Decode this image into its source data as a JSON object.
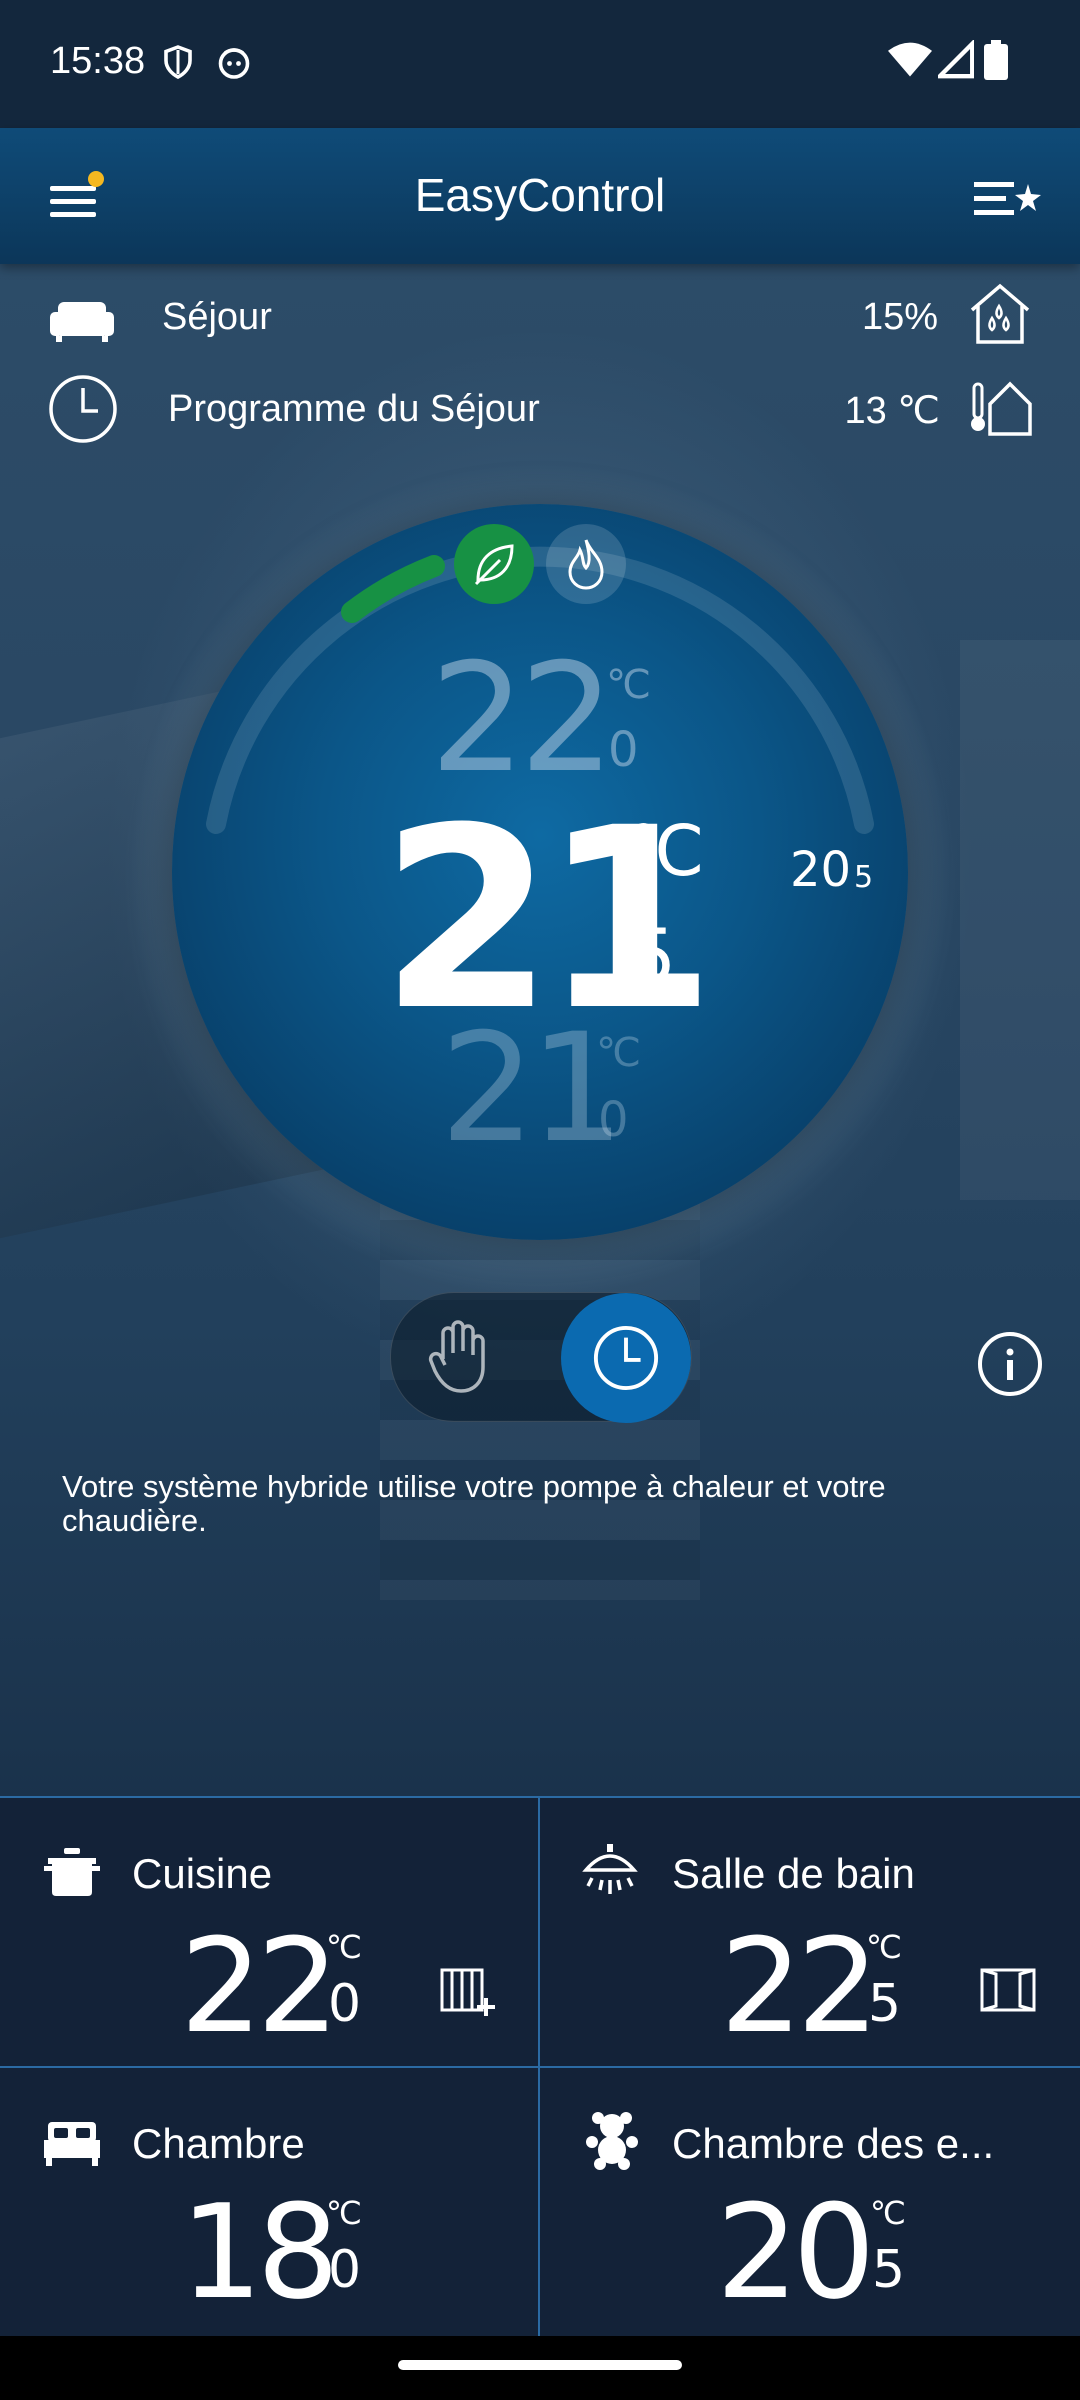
{
  "status_bar": {
    "time": "15:38",
    "icons": [
      "shield-icon",
      "face-icon",
      "wifi-icon",
      "signal-icon",
      "battery-icon"
    ]
  },
  "app_bar": {
    "title": "EasyControl",
    "menu_icon": "menu-icon",
    "filter_icon": "filter-star-icon",
    "notification_dot_color": "#f5b820"
  },
  "room": {
    "name": "Séjour",
    "humidity": "15%",
    "program": "Programme du Séjour",
    "outdoor_temp": "13 ℃"
  },
  "thermostat": {
    "modes": [
      {
        "name": "eco",
        "icon": "leaf-icon",
        "active": true,
        "color": "#179144"
      },
      {
        "name": "boiler",
        "icon": "flame-icon",
        "active": false
      }
    ],
    "above": {
      "int": "22",
      "unit": "℃",
      "dec": "0"
    },
    "current": {
      "int": "21",
      "unit": "℃",
      "dec": "5"
    },
    "below": {
      "int": "21",
      "unit": "℃",
      "dec": "0"
    },
    "measured": {
      "int": "20",
      "dec": "5"
    }
  },
  "mode_toggle": {
    "options": [
      "manual-hand-icon",
      "schedule-clock-icon"
    ],
    "selected": "schedule"
  },
  "message": "Votre système hybride utilise votre pompe à chaleur et votre chaudière.",
  "rooms": [
    {
      "name": "Cuisine",
      "icon": "pot-icon",
      "int": "22",
      "unit": "℃",
      "dec": "0",
      "status_icon": "radiator-plus-icon"
    },
    {
      "name": "Salle de bain",
      "icon": "shower-icon",
      "int": "22",
      "unit": "℃",
      "dec": "5",
      "status_icon": "window-icon"
    },
    {
      "name": "Chambre",
      "icon": "bed-icon",
      "int": "18",
      "unit": "℃",
      "dec": "0"
    },
    {
      "name": "Chambre des e...",
      "icon": "teddy-bear-icon",
      "int": "20",
      "unit": "℃",
      "dec": "5"
    }
  ]
}
